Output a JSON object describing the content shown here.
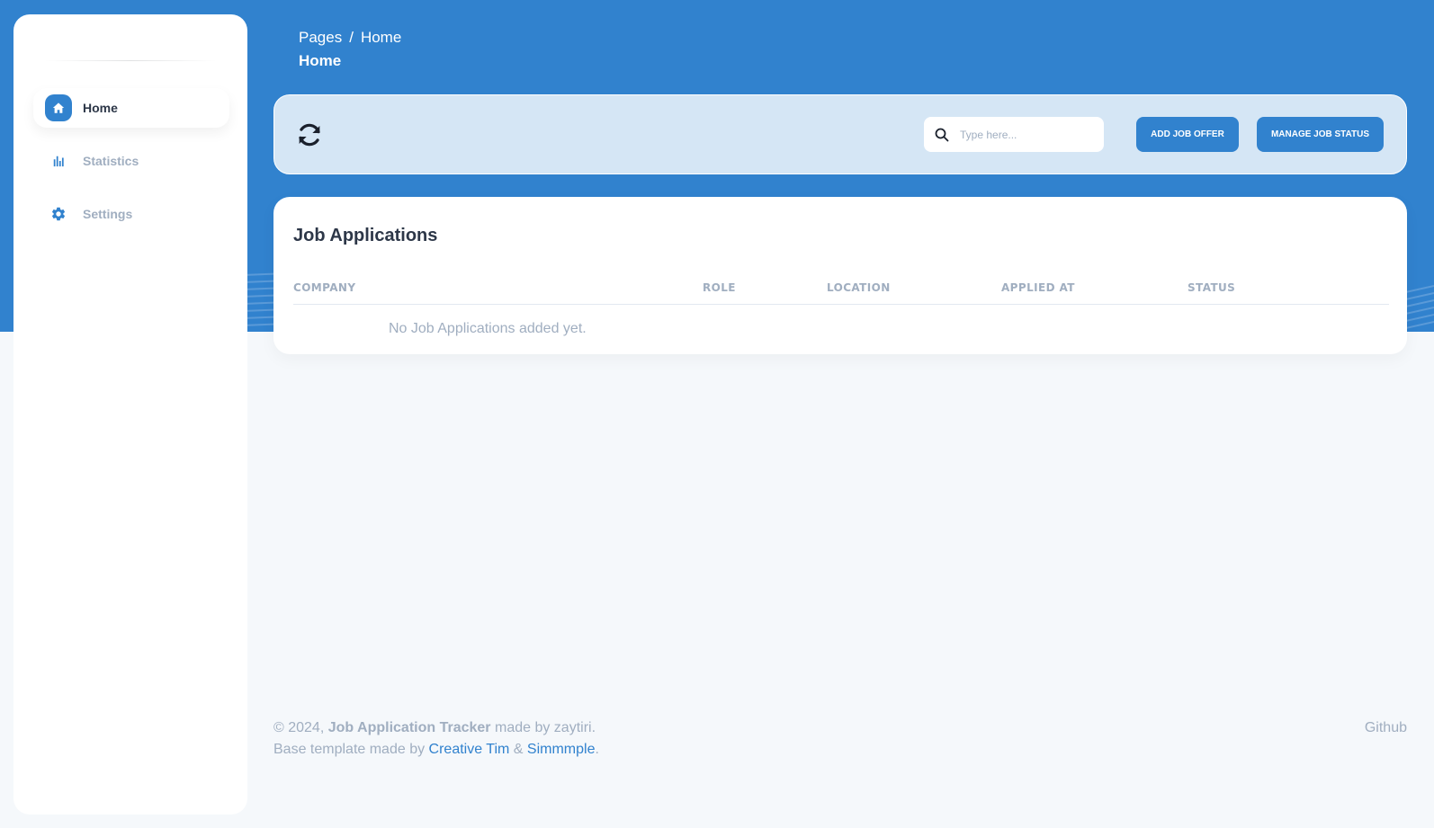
{
  "sidebar": {
    "items": [
      {
        "label": "Home",
        "icon": "home-icon",
        "active": true
      },
      {
        "label": "Statistics",
        "icon": "bar-chart-icon",
        "active": false
      },
      {
        "label": "Settings",
        "icon": "gear-icon",
        "active": false
      }
    ]
  },
  "header": {
    "breadcrumb_root": "Pages",
    "breadcrumb_separator": "/",
    "breadcrumb_current": "Home",
    "page_title": "Home"
  },
  "toolbar": {
    "refresh_icon": "refresh-icon",
    "search_placeholder": "Type here...",
    "search_value": "",
    "add_button": "Add Job Offer",
    "manage_button": "Manage Job Status"
  },
  "table": {
    "title": "Job Applications",
    "columns": [
      "COMPANY",
      "ROLE",
      "LOCATION",
      "APPLIED AT",
      "STATUS"
    ],
    "rows": [],
    "empty_message": "No Job Applications added yet."
  },
  "footer": {
    "copyright": "© 2024,",
    "app_name": "Job Application Tracker",
    "made_by": "made by zaytiri.",
    "template_prefix": "Base template made by",
    "creative_tim": "Creative Tim",
    "ampersand": "&",
    "simmmple": "Simmmple",
    "period": ".",
    "github": "Github"
  },
  "colors": {
    "accent": "#3182ce",
    "page_bg": "#f5f8fb",
    "muted_text": "#a0aec0",
    "dark_text": "#2d3748"
  }
}
